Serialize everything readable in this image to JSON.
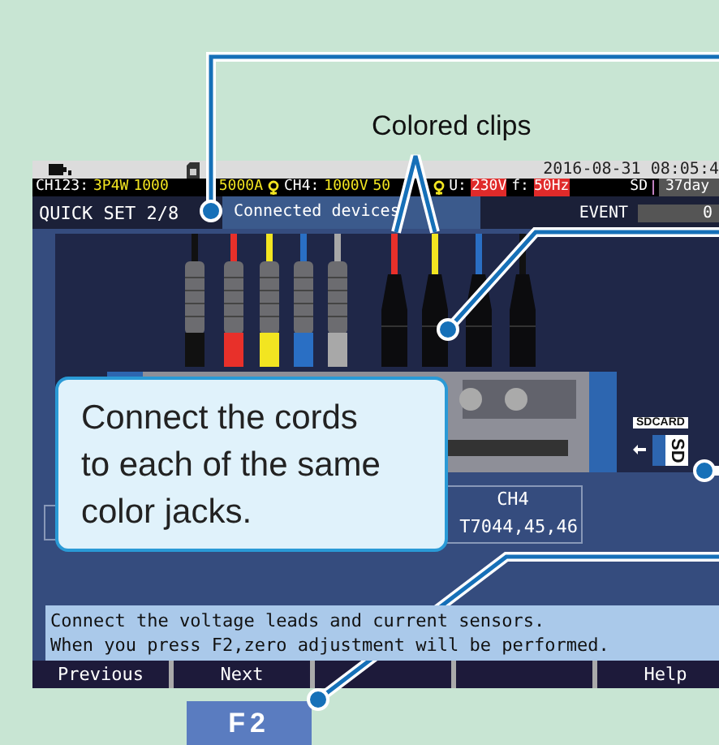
{
  "callouts": {
    "label": "Colored clips",
    "bubble": "Connect the cords to each of the same color jacks."
  },
  "status_bar": {
    "date": "2016-08-31 08:05:4"
  },
  "header": [
    {
      "text": "CH123:",
      "kind": "label"
    },
    {
      "text": "3P4W",
      "kind": "value"
    },
    {
      "text": "1000",
      "kind": "value"
    },
    {
      "text": "5000A",
      "kind": "value",
      "sensor_icon": true
    },
    {
      "text": "CH4:",
      "kind": "label"
    },
    {
      "text": "1000V",
      "kind": "value"
    },
    {
      "text": "50",
      "kind": "value",
      "sensor_icon": true
    },
    {
      "text": "U:",
      "kind": "label"
    },
    {
      "text": "230V",
      "kind": "alert"
    },
    {
      "text": "f:",
      "kind": "label"
    },
    {
      "text": "50Hz",
      "kind": "alert"
    }
  ],
  "storage": {
    "label": "SD",
    "value": "37day",
    "event_label": "EVENT",
    "event_value": "0"
  },
  "title": {
    "step": "QUICK SET 2/8",
    "page": "Connected devices"
  },
  "sd_card": {
    "label": "SDCARD",
    "card": "SD"
  },
  "table": {
    "heading": "CH4",
    "value": "T7044,45,46"
  },
  "message": [
    "Connect the voltage leads and current sensors.",
    "When you press F2,zero adjustment will be performed."
  ],
  "function_keys": {
    "f1": "Previous",
    "f2": "Next",
    "f5": "Help"
  },
  "hardware_key": "F2"
}
